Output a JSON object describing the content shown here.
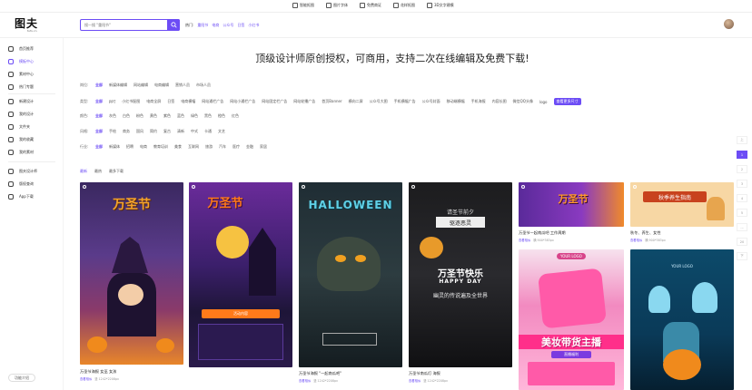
{
  "topbar": {
    "links": [
      {
        "label": "智能抠图"
      },
      {
        "label": "图片字体"
      },
      {
        "label": "免费商证"
      },
      {
        "label": "花样抠图"
      },
      {
        "label": "3D文字建模"
      }
    ]
  },
  "header": {
    "logo_big": "图夫",
    "logo_small": "tufu.cn",
    "search_placeholder": "搜一搜 \"重阳节\"",
    "hot_label": "热门:",
    "hot_keywords": [
      "重阳节",
      "电商",
      "公众号",
      "日签",
      "小红书"
    ]
  },
  "sidebar": {
    "items": [
      {
        "label": "首页推荐",
        "icon": "compass-icon"
      },
      {
        "label": "模板中心",
        "icon": "template-icon",
        "active": true
      },
      {
        "label": "素材中心",
        "icon": "material-icon"
      },
      {
        "label": "热门专题",
        "icon": "fire-icon"
      },
      {
        "label": "新建设计",
        "icon": "plus-icon"
      },
      {
        "label": "我的设计",
        "icon": "folder-icon"
      },
      {
        "label": "文件夹",
        "icon": "file-icon"
      },
      {
        "label": "我的收藏",
        "icon": "star-icon"
      },
      {
        "label": "我的素材",
        "icon": "image-icon"
      },
      {
        "label": "图夫设计师",
        "icon": "designer-icon"
      },
      {
        "label": "版权查询",
        "icon": "copyright-icon"
      },
      {
        "label": "App下载",
        "icon": "phone-icon"
      }
    ],
    "feedback": "功能介绍"
  },
  "banner": "顶级设计师原创授权，可商用，支持二次在线编辑及免费下载!",
  "filters": [
    {
      "label": "岗位:",
      "options": [
        "全部",
        "新媒体编辑",
        "网站编辑",
        "电商编辑",
        "营销人员",
        "市场人员"
      ]
    },
    {
      "label": "类型:",
      "options": [
        "全部",
        "PPT",
        "小红书配图",
        "电商全屏",
        "日签",
        "电商横幅",
        "网站通栏广告",
        "网站小通栏广告",
        "网站固定栏广告",
        "网站轮播广告",
        "首页Banner",
        "横向二屏",
        "公众号大图",
        "手机横幅广告",
        "公众号封面",
        "移动端横幅",
        "手机海报",
        "内容长图",
        "微信QQ头像",
        "logo"
      ],
      "pill": "查看更多尺寸"
    },
    {
      "label": "颜色:",
      "options": [
        "全部",
        "灰色",
        "白色",
        "粉色",
        "黄色",
        "紫色",
        "蓝色",
        "绿色",
        "黑色",
        "橙色",
        "红色"
      ]
    },
    {
      "label": "风格:",
      "options": [
        "全部",
        "手绘",
        "商务",
        "国风",
        "简约",
        "复古",
        "清新",
        "中式",
        "卡通",
        "文艺"
      ]
    },
    {
      "label": "行业:",
      "options": [
        "全部",
        "新媒体",
        "招聘",
        "电商",
        "教育培训",
        "美食",
        "互联网",
        "旅游",
        "汽车",
        "医疗",
        "金融",
        "家居"
      ]
    }
  ],
  "sort": [
    "最新",
    "最热",
    "最多下载"
  ],
  "cards": [
    {
      "title": "万圣节海报 女巫 女孩",
      "tag": "查看相似",
      "size": "竖 1242*2208px",
      "art": "万圣节"
    },
    {
      "title": "",
      "tag": "",
      "size": "",
      "art": "万圣节",
      "sub": "活动内容"
    },
    {
      "title": "万圣节海报 \"一起南瓜吧\"",
      "tag": "查看相似",
      "size": "竖 1242*2208px",
      "art": "HALLOWEEN"
    },
    {
      "title": "万圣节南瓜灯 海报",
      "tag": "查看相似",
      "size": "竖 1242*2208px",
      "art": "万圣节快乐",
      "sub": "HAPPY DAY",
      "line1": "请圣节前夕",
      "line2": "驱逐恶灵",
      "poem": "幽灵的传说遍及全世界"
    },
    {
      "title": "万圣节一起南瓜吧 工作周期",
      "tag": "查看相似",
      "size": "横 900*383px",
      "art": "万圣节"
    },
    {
      "title": "秋冬、养生、女性",
      "tag": "查看相似",
      "size": "横 900*383px",
      "art": "秋季养生指南"
    },
    {
      "title": "",
      "tag": "",
      "size": "",
      "art": "美妆带货主播",
      "sub": "YOUR LOGO",
      "badge": "直播福利"
    },
    {
      "title": "",
      "tag": "",
      "size": "",
      "art": "YOUR LOGO"
    }
  ],
  "rightnav": [
    "上",
    "1",
    "2",
    "3",
    "4",
    "5",
    "...",
    "20",
    "下"
  ]
}
